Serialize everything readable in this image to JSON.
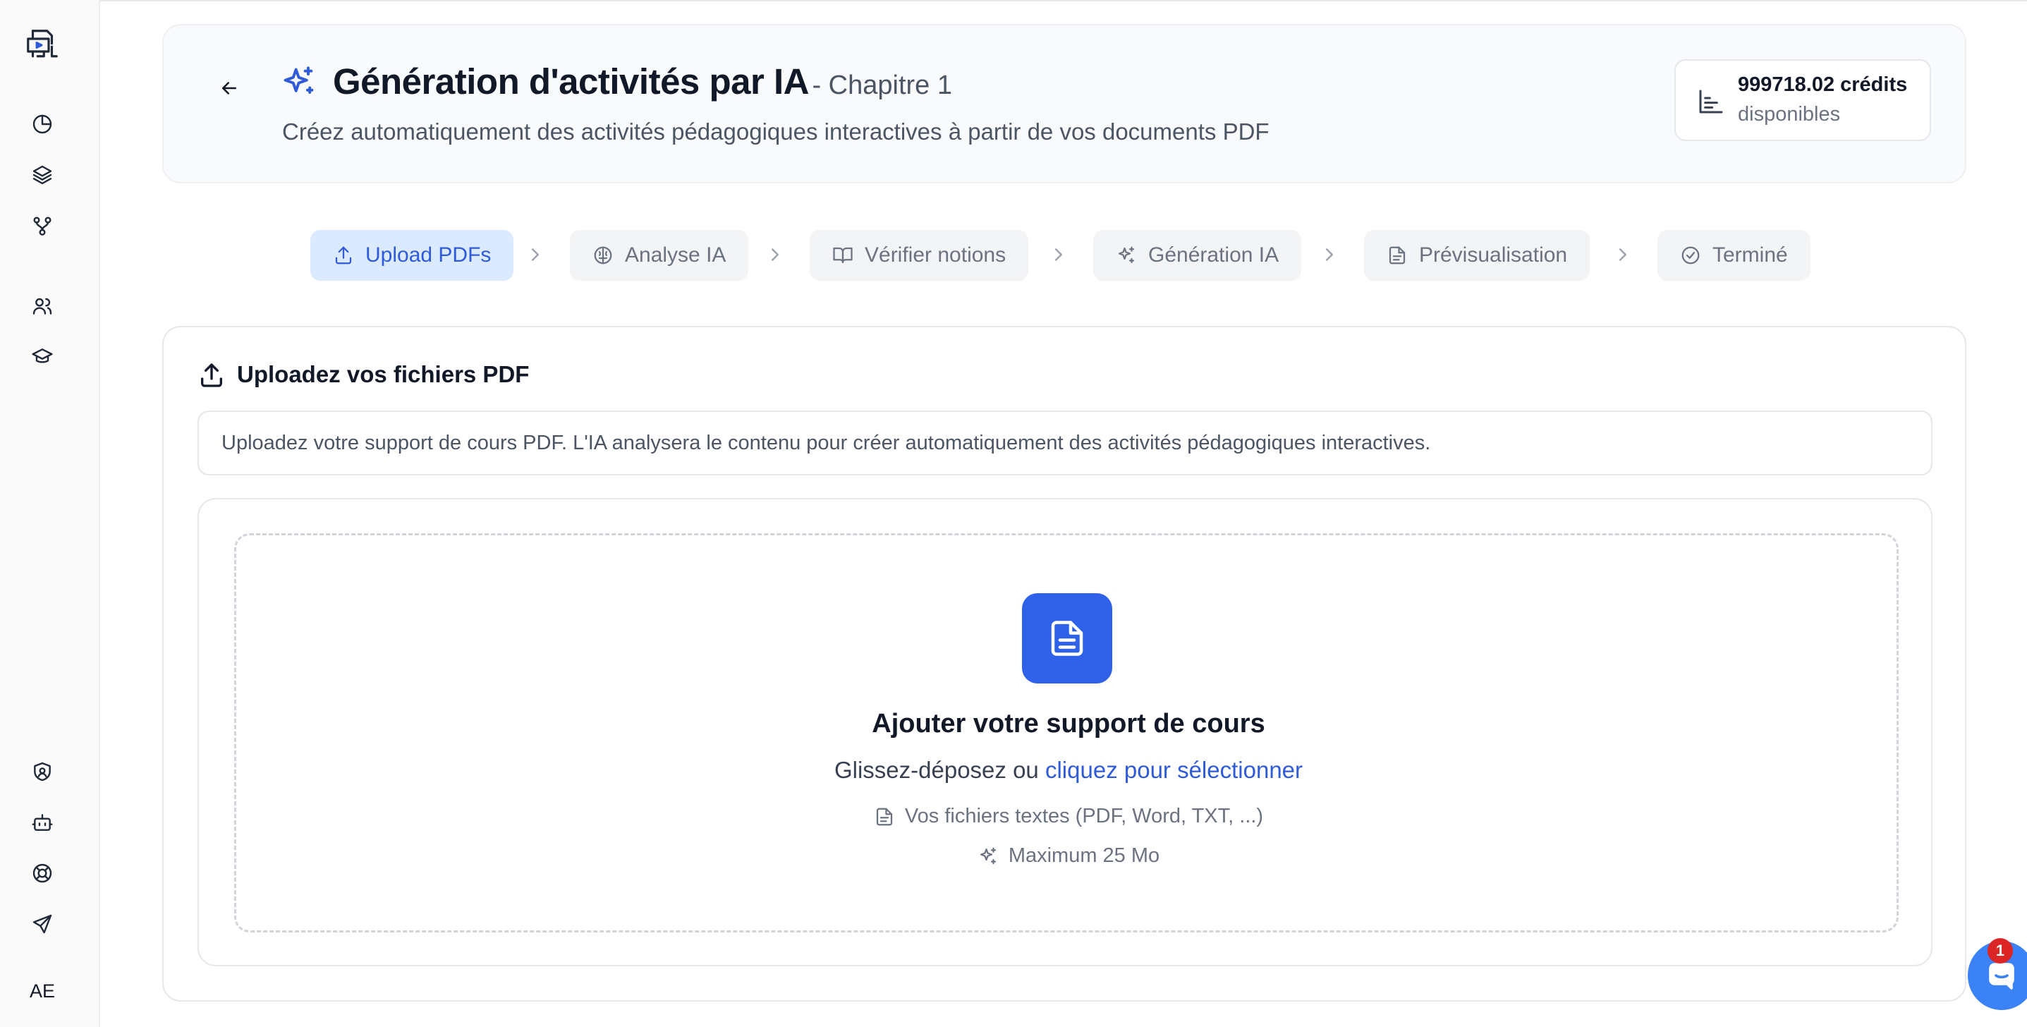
{
  "sidebar": {
    "logo_icon": "presentation-board-icon",
    "nav_icons": [
      "pie-chart-icon",
      "layers-icon",
      "git-branch-icon",
      "users-icon",
      "graduation-cap-icon"
    ],
    "bottom_icons": [
      "shield-icon",
      "bot-icon",
      "lifebuoy-icon",
      "send-icon"
    ],
    "avatar_initials": "AE"
  },
  "header": {
    "title": "Génération d'activités par IA",
    "chapter": "- Chapitre 1",
    "subtitle": "Créez automatiquement des activités pédagogiques interactives à partir de vos documents PDF",
    "credits_value": "999718.02 crédits",
    "credits_label": "disponibles"
  },
  "steps": [
    {
      "label": "Upload PDFs",
      "icon": "upload-icon",
      "active": true
    },
    {
      "label": "Analyse IA",
      "icon": "brain-icon",
      "active": false
    },
    {
      "label": "Vérifier notions",
      "icon": "book-open-icon",
      "active": false
    },
    {
      "label": "Génération IA",
      "icon": "sparkles-icon",
      "active": false
    },
    {
      "label": "Prévisualisation",
      "icon": "file-text-icon",
      "active": false
    },
    {
      "label": "Terminé",
      "icon": "check-circle-icon",
      "active": false
    }
  ],
  "upload": {
    "section_title": "Uploadez vos fichiers PDF",
    "info_text": "Uploadez votre support de cours PDF. L'IA analysera le contenu pour créer automatiquement des activités pédagogiques interactives.",
    "dropzone_title": "Ajouter votre support de cours",
    "dropzone_text": "Glissez-déposez ou",
    "dropzone_link": "cliquez pour sélectionner",
    "hint_formats": "Vos fichiers textes (PDF, Word, TXT, ...)",
    "hint_max": "Maximum 25 Mo"
  },
  "chat": {
    "badge_count": "1"
  },
  "colors": {
    "accent": "#2f5bd8",
    "active_step_bg": "#dbeafe",
    "doc_tile": "#2f62e9",
    "badge": "#dc2626"
  }
}
